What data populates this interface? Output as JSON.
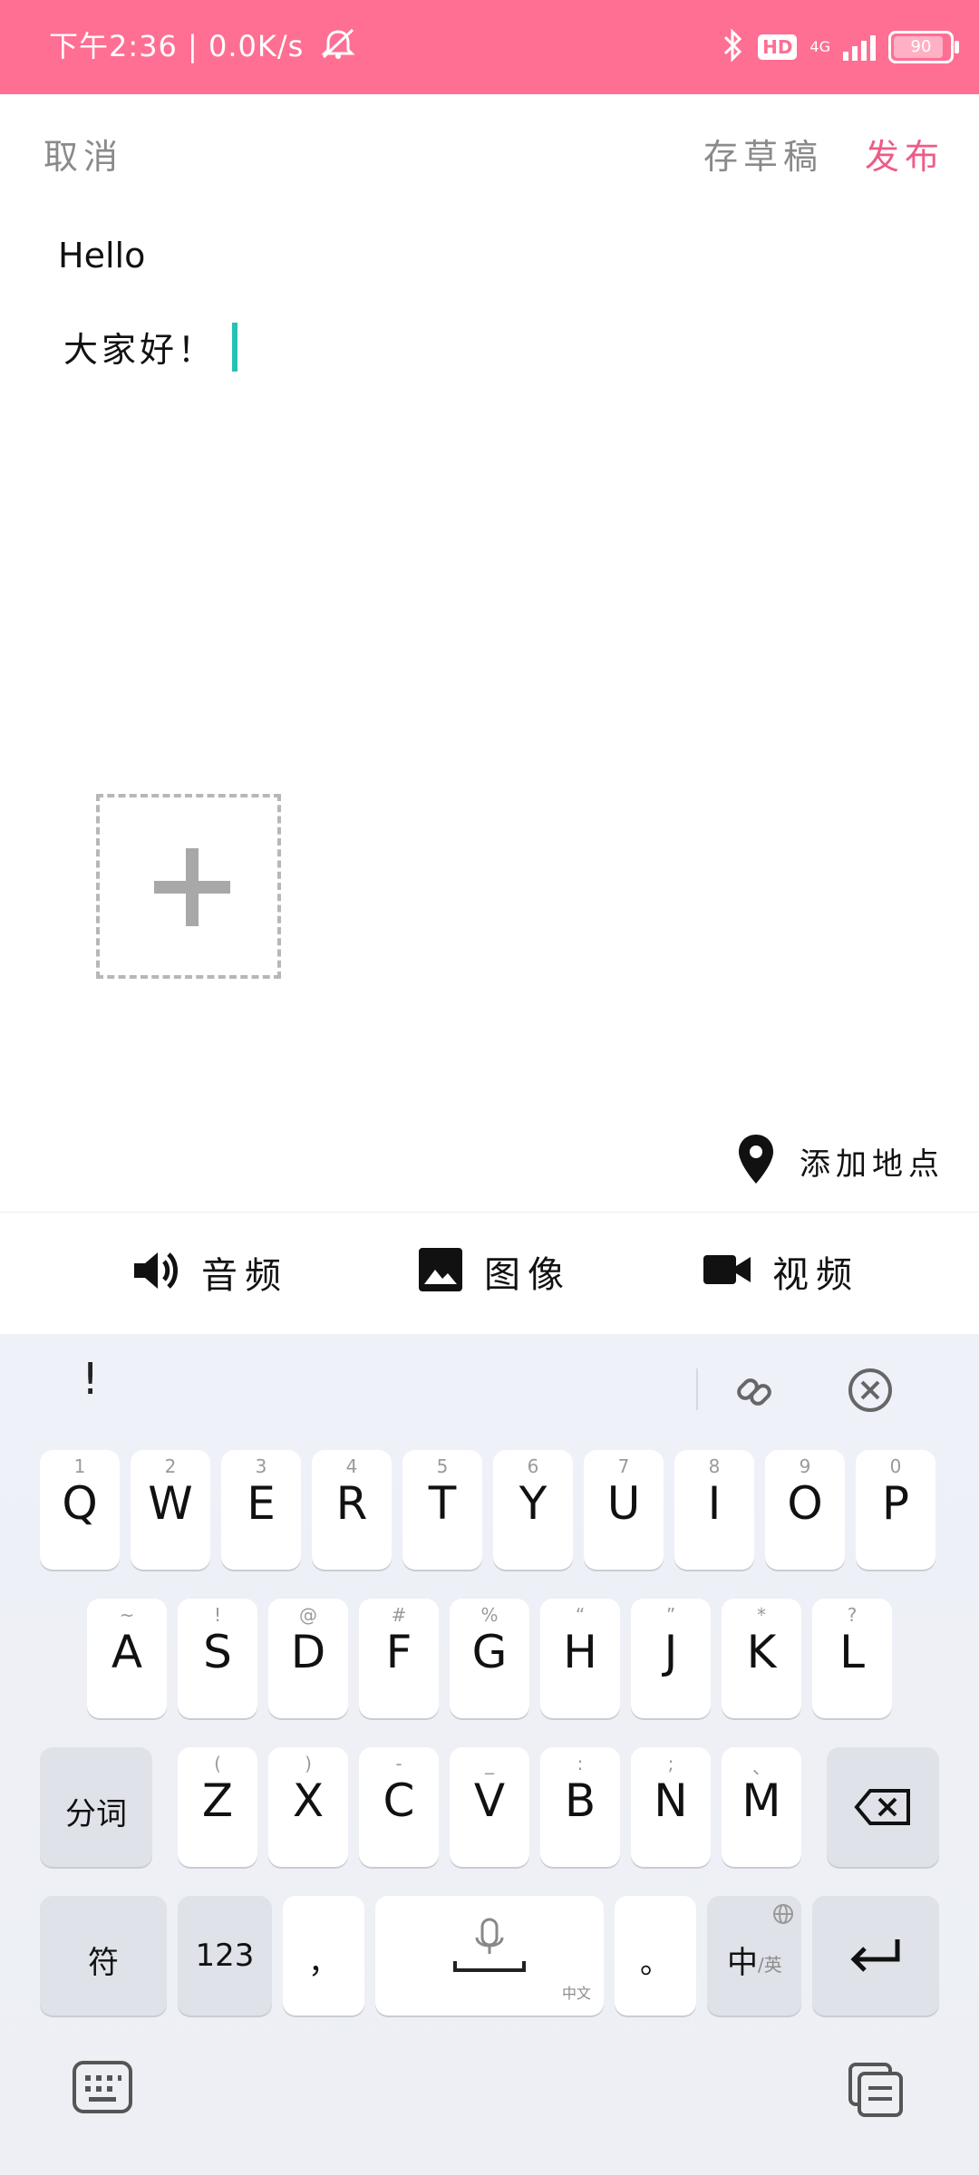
{
  "status_bar": {
    "time": "下午2:36",
    "speed": "0.0K/s",
    "network": "4G",
    "battery": "90",
    "battery_fraction": 0.9
  },
  "topbar": {
    "cancel": "取消",
    "save_draft": "存草稿",
    "publish": "发布"
  },
  "editor": {
    "title": "Hello",
    "body": "大家好！"
  },
  "location": {
    "label": "添加地点"
  },
  "media": {
    "audio": "音频",
    "image": "图像",
    "video": "视频"
  },
  "keyboard": {
    "candidate": "!",
    "row1": [
      {
        "key": "Q",
        "hint": "1"
      },
      {
        "key": "W",
        "hint": "2"
      },
      {
        "key": "E",
        "hint": "3"
      },
      {
        "key": "R",
        "hint": "4"
      },
      {
        "key": "T",
        "hint": "5"
      },
      {
        "key": "Y",
        "hint": "6"
      },
      {
        "key": "U",
        "hint": "7"
      },
      {
        "key": "I",
        "hint": "8"
      },
      {
        "key": "O",
        "hint": "9"
      },
      {
        "key": "P",
        "hint": "0"
      }
    ],
    "row2": [
      {
        "key": "A",
        "hint": "~"
      },
      {
        "key": "S",
        "hint": "!"
      },
      {
        "key": "D",
        "hint": "@"
      },
      {
        "key": "F",
        "hint": "#"
      },
      {
        "key": "G",
        "hint": "%"
      },
      {
        "key": "H",
        "hint": "“"
      },
      {
        "key": "J",
        "hint": "”"
      },
      {
        "key": "K",
        "hint": "*"
      },
      {
        "key": "L",
        "hint": "?"
      }
    ],
    "row3": [
      {
        "key": "Z",
        "hint": "("
      },
      {
        "key": "X",
        "hint": ")"
      },
      {
        "key": "C",
        "hint": "-"
      },
      {
        "key": "V",
        "hint": "_"
      },
      {
        "key": "B",
        "hint": ":"
      },
      {
        "key": "N",
        "hint": ";"
      },
      {
        "key": "M",
        "hint": "、"
      }
    ],
    "fenci": "分词",
    "symbols": "符",
    "numbers": "123",
    "comma": "，",
    "space_sub": "中文",
    "period": "。",
    "lang_main": "中",
    "lang_sub": "/英"
  }
}
